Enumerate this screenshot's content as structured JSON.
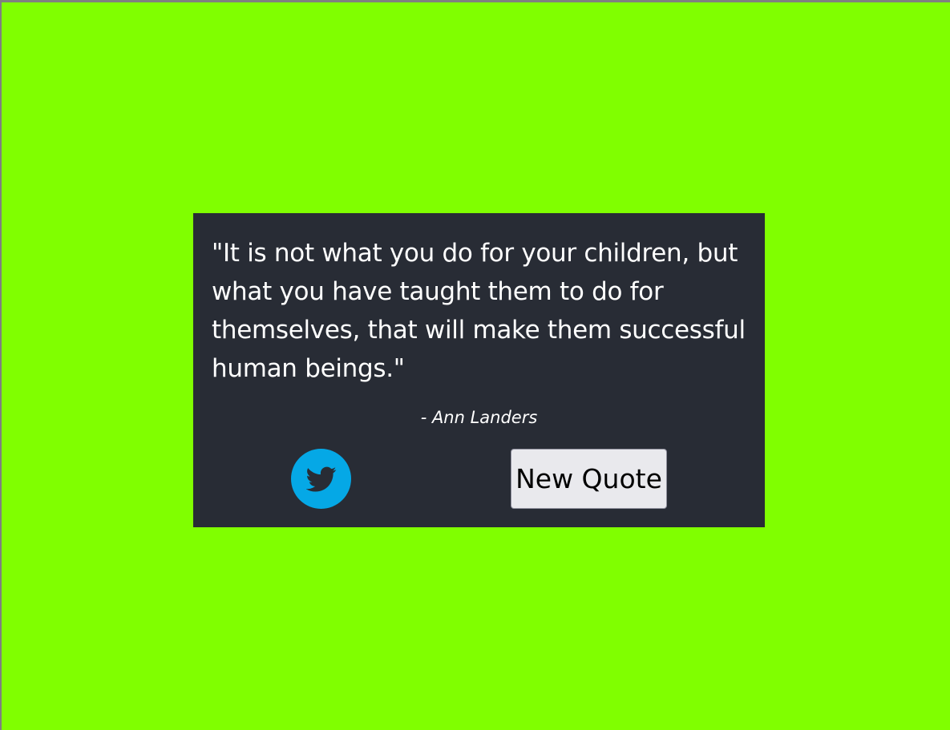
{
  "colors": {
    "page_background": "#80ff00",
    "quote_box_background": "#282c35",
    "text": "#ffffff",
    "twitter_blue": "#05a8e6",
    "button_background": "#e9e9ed"
  },
  "quote": {
    "text": "\"It is not what you do for your children, but what you have taught them to do for themselves, that will make them successful human beings.\"",
    "author": "- Ann Landers"
  },
  "actions": {
    "tweet_icon": "twitter-bird-icon",
    "new_quote_label": "New Quote"
  }
}
